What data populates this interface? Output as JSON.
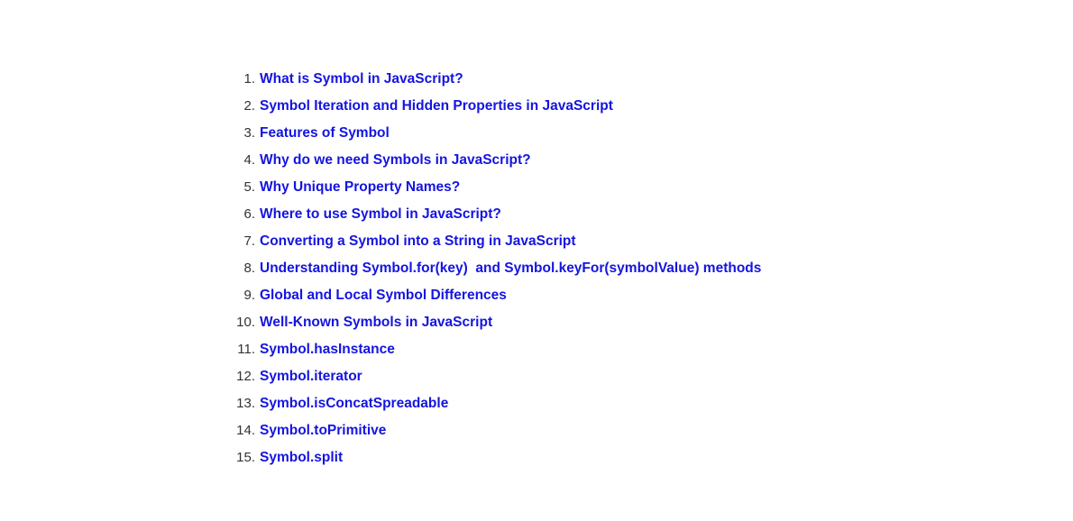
{
  "page": {
    "background_color": "#ffffff",
    "link_color": "#1414e0",
    "marker_color": "#333333"
  },
  "toc": {
    "items": [
      {
        "marker": "1.",
        "label": "What is Symbol in JavaScript?"
      },
      {
        "marker": "2.",
        "label": "Symbol Iteration and Hidden Properties in JavaScript"
      },
      {
        "marker": "3.",
        "label": "Features of Symbol"
      },
      {
        "marker": "4.",
        "label": "Why do we need Symbols in JavaScript?"
      },
      {
        "marker": "5.",
        "label": "Why Unique Property Names?"
      },
      {
        "marker": "6.",
        "label": "Where to use Symbol in JavaScript?"
      },
      {
        "marker": "7.",
        "label": "Converting a Symbol into a String in JavaScript"
      },
      {
        "marker": "8.",
        "label": "Understanding Symbol.for(key)  and Symbol.keyFor(symbolValue) methods"
      },
      {
        "marker": "9.",
        "label": "Global and Local Symbol Differences"
      },
      {
        "marker": "10.",
        "label": "Well-Known Symbols in JavaScript"
      },
      {
        "marker": "11.",
        "label": "Symbol.hasInstance"
      },
      {
        "marker": "12.",
        "label": "Symbol.iterator"
      },
      {
        "marker": "13.",
        "label": "Symbol.isConcatSpreadable"
      },
      {
        "marker": "14.",
        "label": "Symbol.toPrimitive"
      },
      {
        "marker": "15.",
        "label": "Symbol.split"
      }
    ]
  }
}
